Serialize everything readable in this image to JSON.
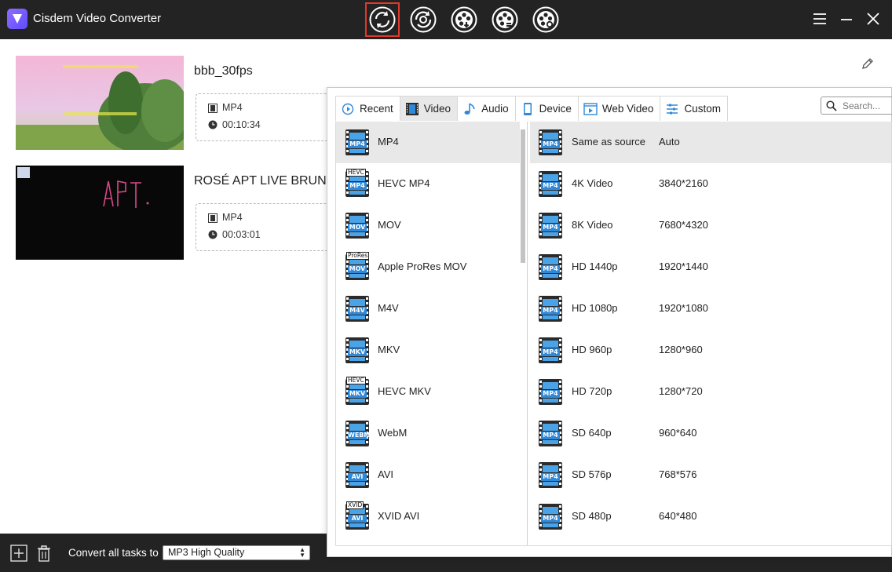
{
  "app": {
    "title": "Cisdem Video Converter",
    "accent_color": "#e0392d",
    "tools": [
      {
        "name": "convert-tool",
        "icon": "convert-icon",
        "active": true
      },
      {
        "name": "rip-tool",
        "icon": "rip-icon"
      },
      {
        "name": "download-tool",
        "icon": "download-icon"
      },
      {
        "name": "compress-tool",
        "icon": "compress-icon"
      },
      {
        "name": "burn-tool",
        "icon": "burn-icon"
      }
    ]
  },
  "tasks": [
    {
      "name": "bbb_30fps",
      "format": "MP4",
      "duration": "00:10:34"
    },
    {
      "name": "ROSÉ APT LIVE BRUNC",
      "format": "MP4",
      "duration": "00:03:01"
    }
  ],
  "bottom_bar": {
    "convert_all_label": "Convert all tasks to",
    "convert_all_value": "MP3 High Quality"
  },
  "panel": {
    "tabs": [
      {
        "label": "Recent",
        "icon": "recent-icon"
      },
      {
        "label": "Video",
        "icon": "video-icon",
        "active": true
      },
      {
        "label": "Audio",
        "icon": "audio-icon"
      },
      {
        "label": "Device",
        "icon": "device-icon"
      },
      {
        "label": "Web Video",
        "icon": "web-video-icon"
      },
      {
        "label": "Custom",
        "icon": "custom-icon"
      }
    ],
    "search_placeholder": "Search...",
    "formats": [
      {
        "label": "MP4",
        "tag": "MP4",
        "selected": true
      },
      {
        "label": "HEVC MP4",
        "tag": "MP4",
        "top_tag": "HEVC"
      },
      {
        "label": "MOV",
        "tag": "MOV"
      },
      {
        "label": "Apple ProRes MOV",
        "tag": "MOV",
        "top_tag": "ProRes"
      },
      {
        "label": "M4V",
        "tag": "M4V"
      },
      {
        "label": "MKV",
        "tag": "MKV"
      },
      {
        "label": "HEVC MKV",
        "tag": "MKV",
        "top_tag": "HEVC"
      },
      {
        "label": "WebM",
        "tag": "WEBM"
      },
      {
        "label": "AVI",
        "tag": "AVI"
      },
      {
        "label": "XVID AVI",
        "tag": "AVI",
        "top_tag": "XVID"
      }
    ],
    "resolutions": [
      {
        "name": "Same as source",
        "value": "Auto",
        "selected": true
      },
      {
        "name": "4K Video",
        "value": "3840*2160"
      },
      {
        "name": "8K Video",
        "value": "7680*4320"
      },
      {
        "name": "HD 1440p",
        "value": "1920*1440"
      },
      {
        "name": "HD 1080p",
        "value": "1920*1080"
      },
      {
        "name": "HD 960p",
        "value": "1280*960"
      },
      {
        "name": "HD 720p",
        "value": "1280*720"
      },
      {
        "name": "SD 640p",
        "value": "960*640"
      },
      {
        "name": "SD 576p",
        "value": "768*576"
      },
      {
        "name": "SD 480p",
        "value": "640*480"
      }
    ],
    "resolution_tag": "MP4"
  }
}
